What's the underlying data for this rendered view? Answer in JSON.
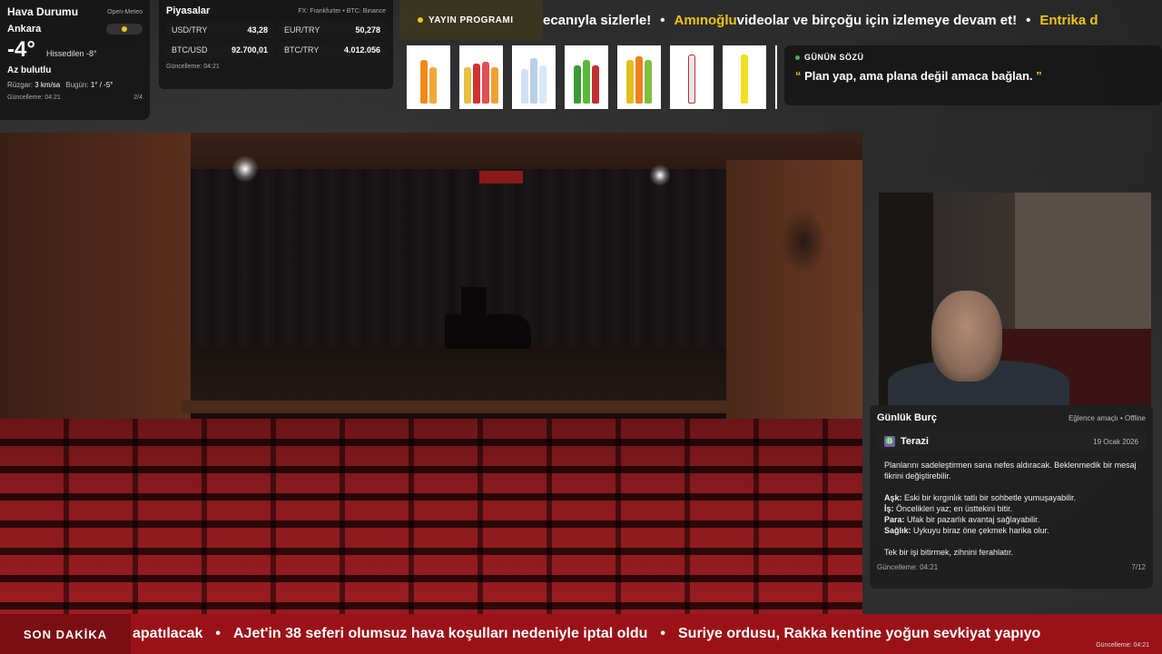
{
  "weather": {
    "title": "Hava Durumu",
    "source": "Open-Meteo",
    "city": "Ankara",
    "temperature": "-4°",
    "feels_like": "Hissedilen -8°",
    "condition": "Az bulutlu",
    "wind_label": "Rüzgar:",
    "wind_value": "3 km/sa",
    "today_label": "Bugün:",
    "today_value": "1° / -5°",
    "updated": "Güncelleme: 04:21",
    "page": "2/4"
  },
  "markets": {
    "title": "Piyasalar",
    "source": "FX: Frankfurter • BTC: Binance",
    "items": [
      {
        "symbol": "USD/TRY",
        "value": "43,28"
      },
      {
        "symbol": "EUR/TRY",
        "value": "50,278"
      },
      {
        "symbol": "BTC/USD",
        "value": "92.700,01"
      },
      {
        "symbol": "BTC/TRY",
        "value": "4.012.056"
      }
    ],
    "updated": "Güncelleme: 04:21"
  },
  "schedule_button": "YAYIN PROGRAMI",
  "top_ticker": {
    "part1": "ecanıyla sizlerle!",
    "part2_highlight": "Amınoğlu",
    "part2_rest": " videolar ve birçoğu için izlemeye devam et!",
    "part3_highlight": "Entrika d"
  },
  "quote": {
    "label": "GÜNÜN SÖZÜ",
    "open_mark": "“",
    "text": " Plan yap, ama plana değil amaca bağlan. ",
    "close_mark": "”"
  },
  "horoscope": {
    "title": "Günlük Burç",
    "tag": "Eğlence amaçlı • Offline",
    "sign": "Terazi",
    "sign_icon": "♎",
    "date": "19 Ocak 2026",
    "intro": "Planlarını sadeleştirmen sana nefes aldıracak. Beklenmedik bir mesaj fikrini değiştirebilir.",
    "love_label": "Aşk:",
    "love": " Eski bir kırgınlık tatlı bir sohbetle yumuşayabilir.",
    "work_label": "İş:",
    "work": " Öncelikleri yaz; en üsttekini bitir.",
    "money_label": "Para:",
    "money": " Ufak bir pazarlık avantaj sağlayabilir.",
    "health_label": "Sağlık:",
    "health": " Uykuyu biraz öne çekmek harika olur.",
    "advice": "Tek bir işi bitirmek, zihnini ferahlatır.",
    "updated": "Güncelleme: 04:21",
    "page": "7/12"
  },
  "breaking": {
    "label": "SON DAKİKA",
    "item1": "apatılacak",
    "item2": "AJet'in 38 seferi olumsuz hava koşulları nedeniyle iptal oldu",
    "item3": "Suriye ordusu, Rakka kentine yoğun sevkiyat yapıyo",
    "updated": "Güncelleme: 04:21"
  },
  "colors": {
    "accent": "#f0c419",
    "breaking_red": "#9a1218",
    "live_green": "#4caf50"
  }
}
